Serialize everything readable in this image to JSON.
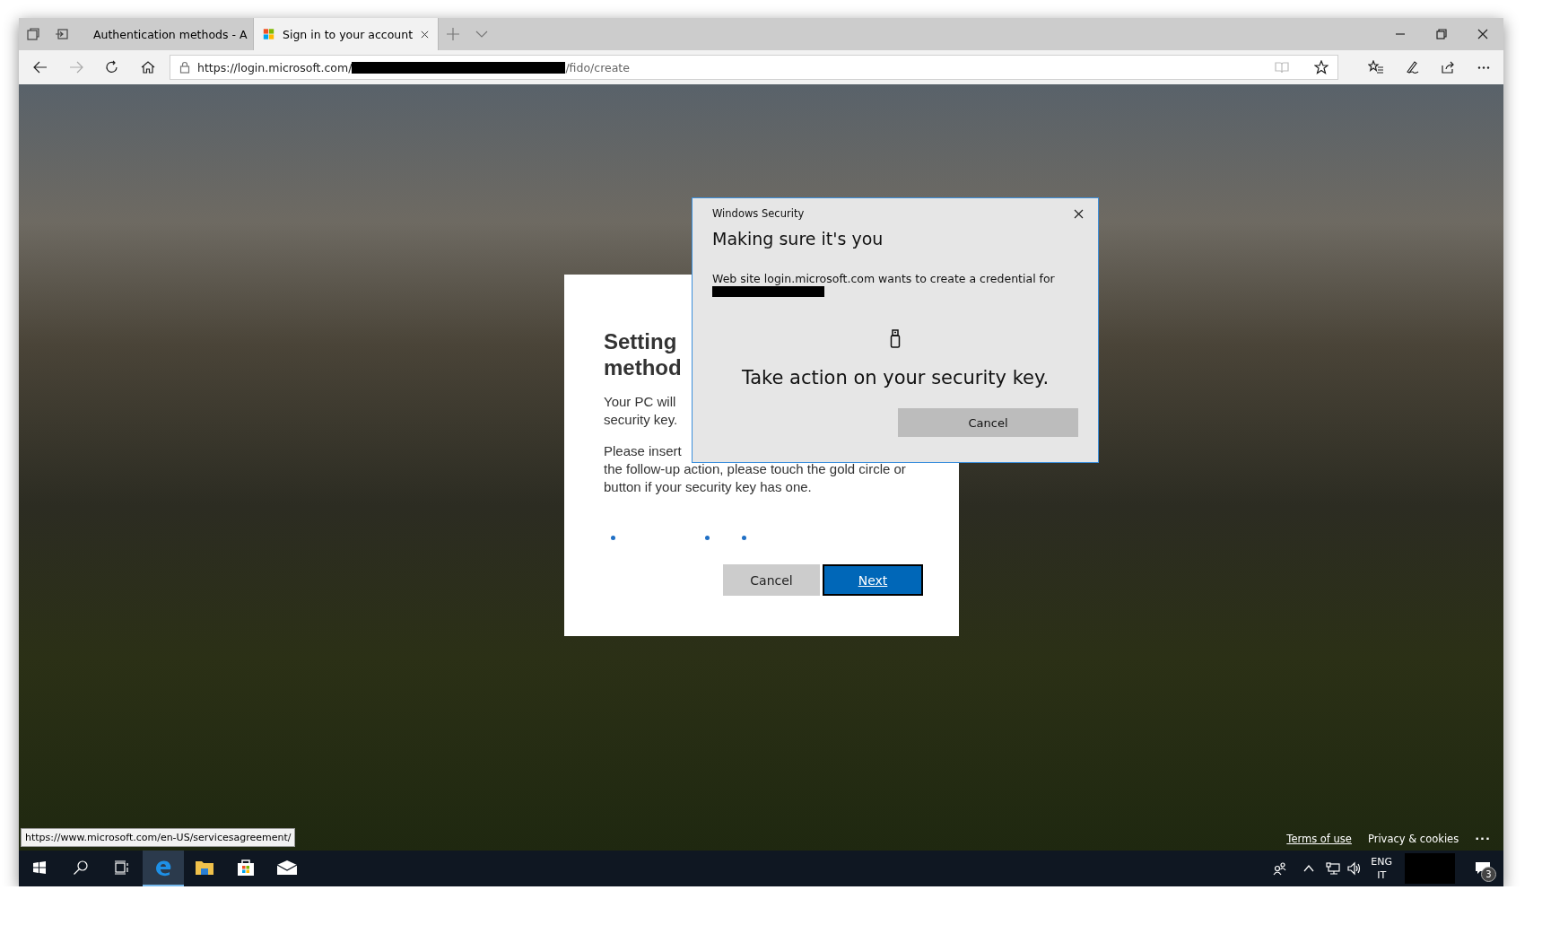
{
  "browser": {
    "tabs": [
      {
        "title": "Authentication methods - A",
        "selected": false
      },
      {
        "title": "Sign in to your account",
        "selected": true
      }
    ],
    "address": {
      "prefix": "https://login.microsoft.com/",
      "suffix": "/fido/create"
    }
  },
  "card": {
    "heading_lines": [
      "Setting",
      "method"
    ],
    "paragraphs": [
      [
        "Your PC will",
        "security key."
      ],
      [
        "Please insert",
        "the follow-up action, please touch the gold circle or",
        "button if your security key has one."
      ]
    ],
    "buttons": [
      {
        "label": "Cancel",
        "kind": "secondary"
      },
      {
        "label": "Next",
        "kind": "primary"
      }
    ]
  },
  "dialog": {
    "caption": "Windows Security",
    "title": "Making sure it's you",
    "message": "Web site login.microsoft.com wants to create a credential for",
    "prompt": "Take action on your security key.",
    "button": "Cancel"
  },
  "status_url": "https://www.microsoft.com/en-US/servicesagreement/",
  "footer": {
    "links": [
      {
        "label": "Terms of use",
        "underlined": true
      },
      {
        "label": "Privacy & cookies",
        "underlined": false
      }
    ],
    "more": "···"
  },
  "taskbar": {
    "apps": [
      {
        "kind": "edge",
        "selected": true
      },
      {
        "kind": "explorer",
        "selected": false
      },
      {
        "kind": "store",
        "selected": false
      },
      {
        "kind": "mail",
        "selected": false
      }
    ],
    "language": [
      "ENG",
      "IT"
    ],
    "notifications": "3"
  }
}
